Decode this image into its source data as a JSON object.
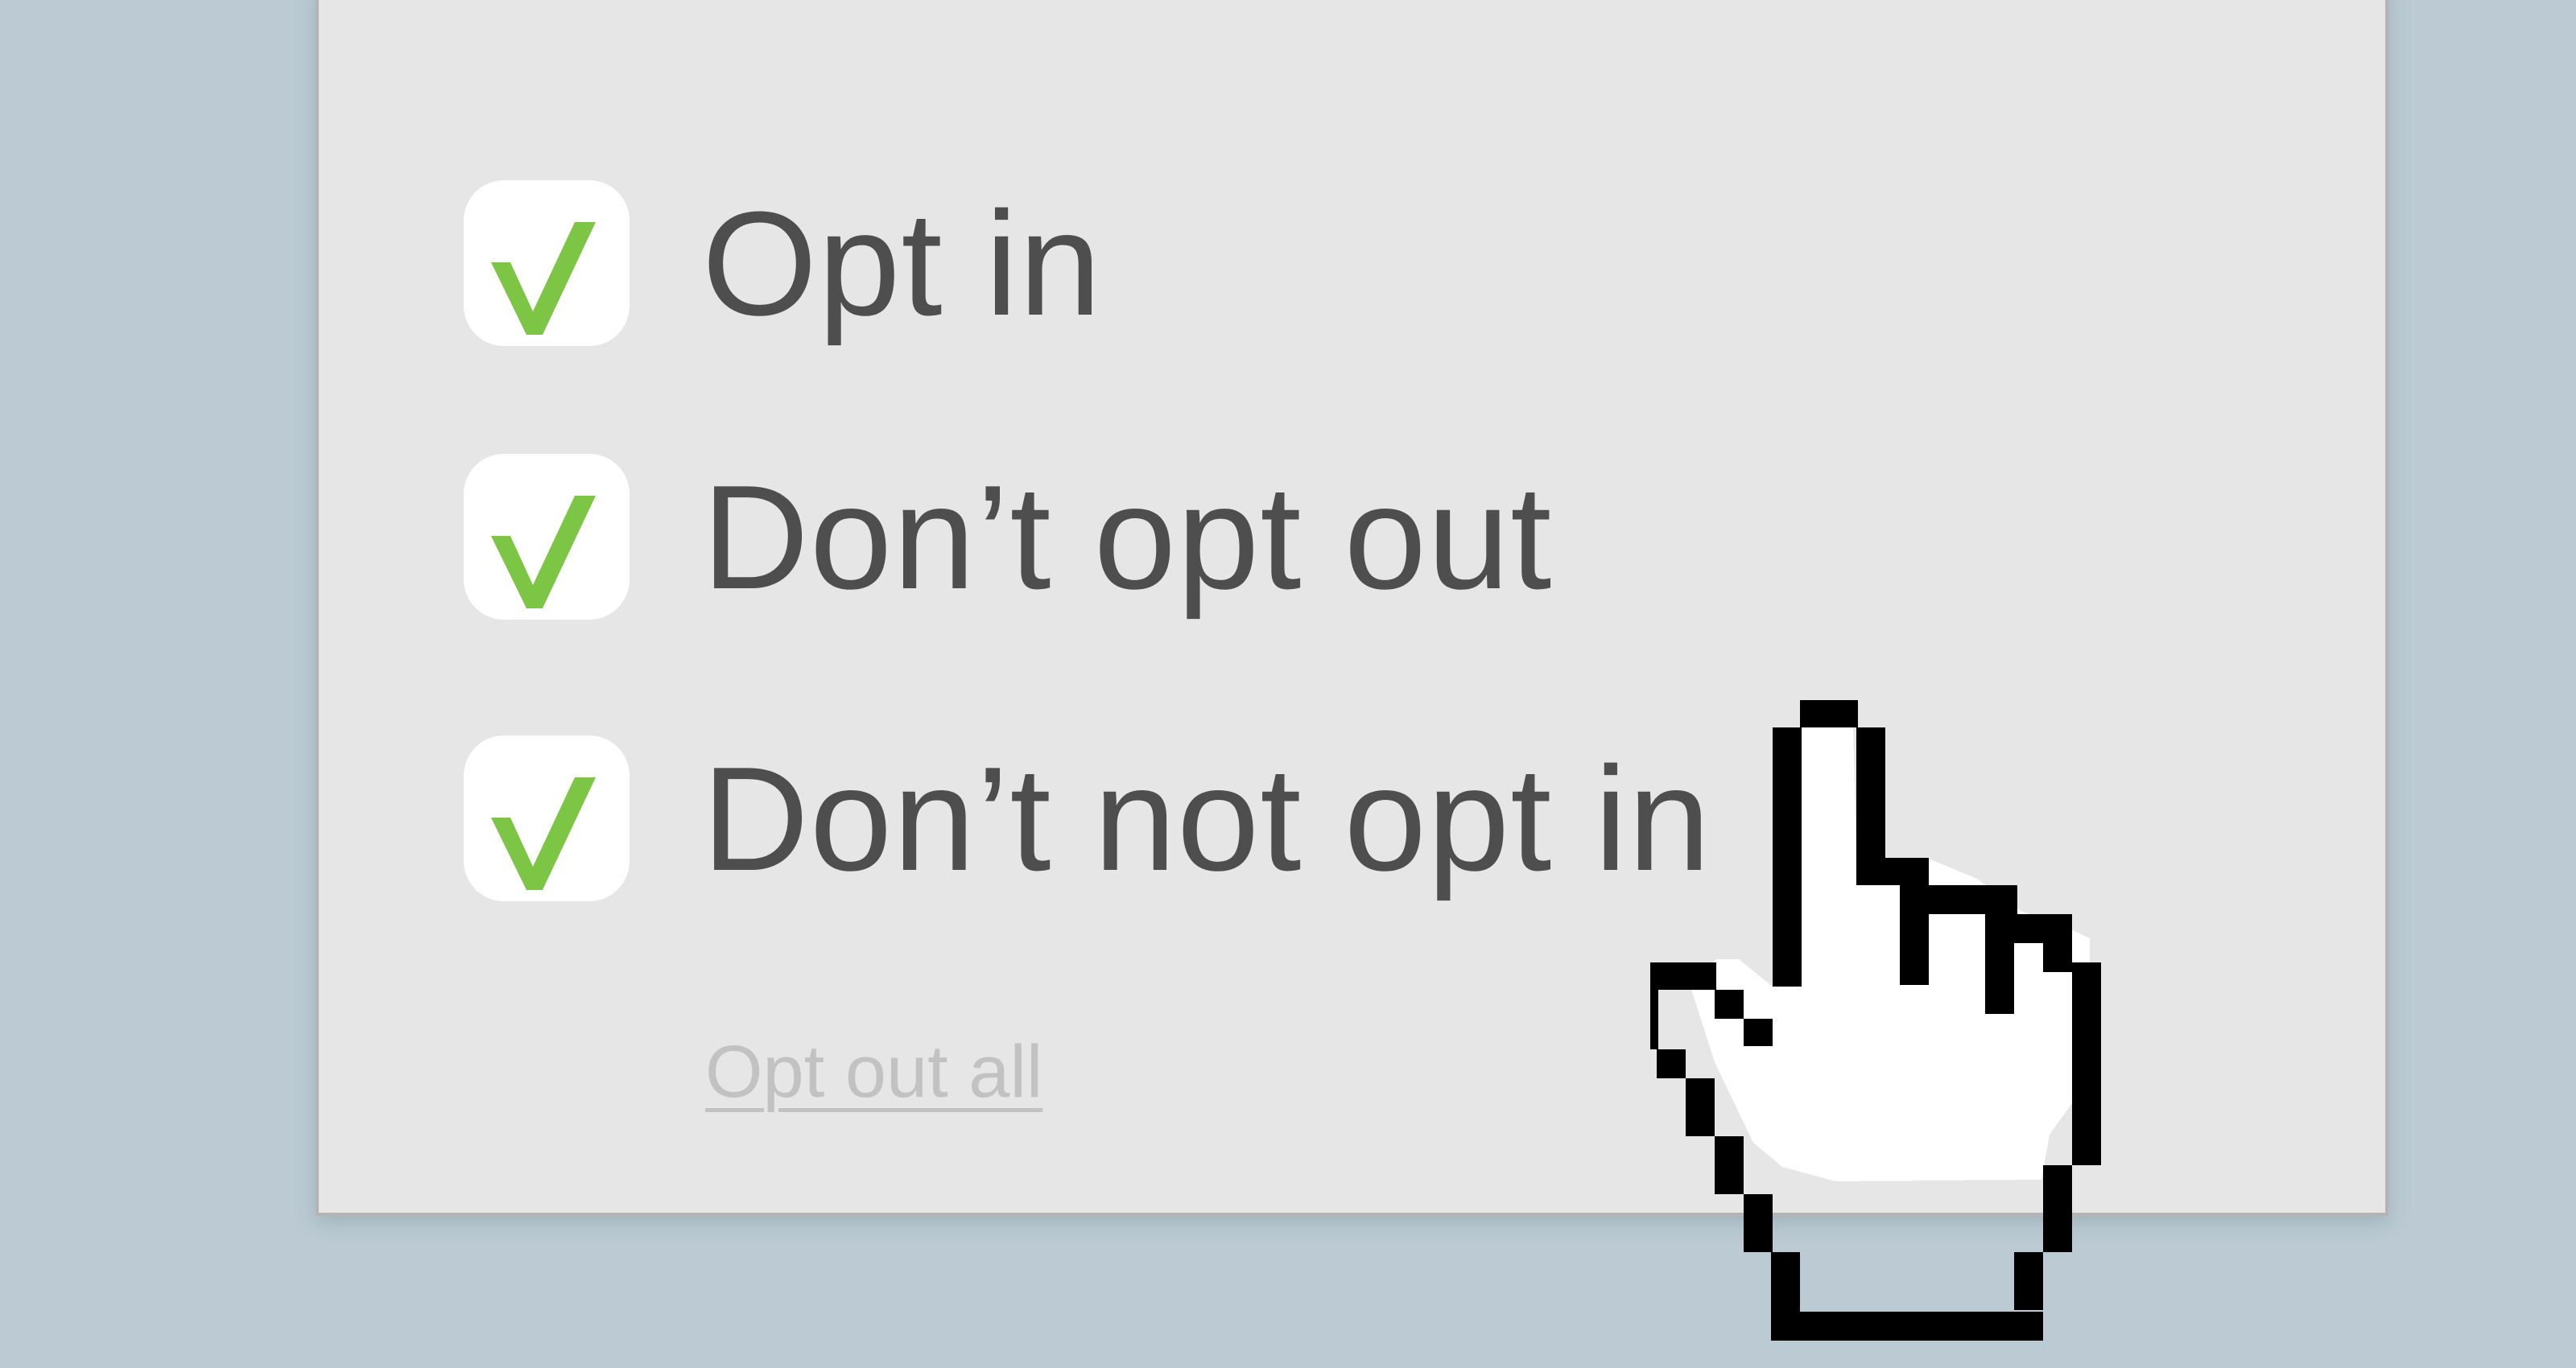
{
  "options": [
    {
      "label": "Opt in",
      "checked": true
    },
    {
      "label": "Don’t opt out",
      "checked": true
    },
    {
      "label": "Don’t not opt in",
      "checked": true
    }
  ],
  "link": {
    "label": "Opt out all"
  },
  "colors": {
    "background": "#bccbd3",
    "panel": "#e6e6e6",
    "checkmark": "#7dc544",
    "label_text": "#4e4e4e",
    "link_text": "#c2c2c2"
  },
  "cursor": {
    "icon": "pointing-hand-cursor-icon"
  }
}
